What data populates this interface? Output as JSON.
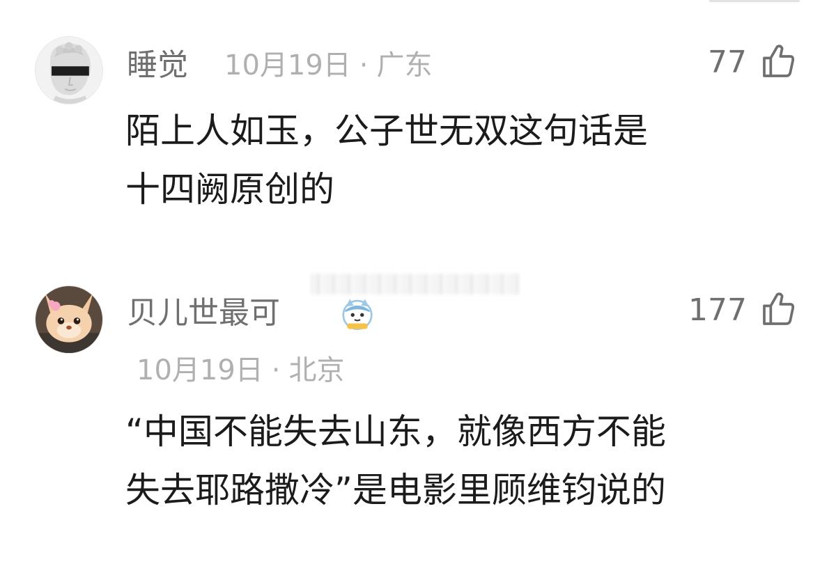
{
  "comments": [
    {
      "username": "睡觉",
      "date": "10月19日",
      "separator": "·",
      "location": "广东",
      "likes": "77",
      "lines": [
        "陌上人如玉，公子世无双这句话是",
        "十四阙原创的"
      ]
    },
    {
      "username": "贝儿世最可",
      "date": "10月19日",
      "separator": "·",
      "location": "北京",
      "likes": "177",
      "lines": [
        "“中国不能失去山东，就像西方不能",
        "失去耶路撒冷”是电影里顾维钧说的"
      ]
    }
  ],
  "icons": {
    "like": "thumbs-up-icon",
    "badge": "cat-badge-icon"
  },
  "colors": {
    "text_primary": "#1b1b1b",
    "text_username": "#6f6f6f",
    "text_meta": "#b0b0b0"
  }
}
